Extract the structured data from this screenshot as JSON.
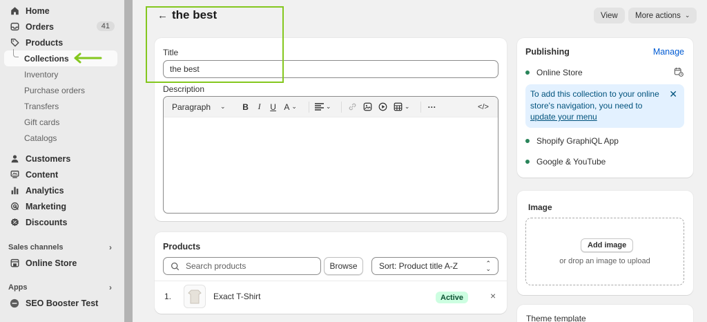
{
  "sidebar": {
    "items": [
      {
        "label": "Home",
        "icon": "home-icon"
      },
      {
        "label": "Orders",
        "icon": "inbox-icon",
        "badge": "41"
      },
      {
        "label": "Products",
        "icon": "tag-icon"
      }
    ],
    "products_sub": [
      {
        "label": "Collections",
        "active": true
      },
      {
        "label": "Inventory"
      },
      {
        "label": "Purchase orders"
      },
      {
        "label": "Transfers"
      },
      {
        "label": "Gift cards"
      },
      {
        "label": "Catalogs"
      }
    ],
    "items2": [
      {
        "label": "Customers",
        "icon": "person-icon"
      },
      {
        "label": "Content",
        "icon": "content-icon"
      },
      {
        "label": "Analytics",
        "icon": "bar-chart-icon"
      },
      {
        "label": "Marketing",
        "icon": "target-icon"
      },
      {
        "label": "Discounts",
        "icon": "discount-icon"
      }
    ],
    "sales_channels_title": "Sales channels",
    "online_store": "Online Store",
    "apps_title": "Apps",
    "seo_app": "SEO Booster Test"
  },
  "header": {
    "title": "the best",
    "view_label": "View",
    "more_actions_label": "More actions"
  },
  "details": {
    "title_label": "Title",
    "title_value": "the best",
    "description_label": "Description",
    "format_label": "Paragraph"
  },
  "products": {
    "title": "Products",
    "search_placeholder": "Search products",
    "browse_label": "Browse",
    "sort_label": "Sort: Product title A-Z",
    "rows": [
      {
        "index": "1.",
        "name": "Exact T-Shirt",
        "status": "Active"
      }
    ]
  },
  "publishing": {
    "title": "Publishing",
    "manage_label": "Manage",
    "channels": [
      "Online Store",
      "Shopify GraphiQL App",
      "Google & YouTube"
    ],
    "banner_text": "To add this collection to your online store's navigation, you need to ",
    "banner_link": "update your menu"
  },
  "image_card": {
    "title": "Image",
    "add_label": "Add image",
    "drop_text": "or drop an image to upload"
  },
  "theme_card": {
    "title": "Theme template"
  },
  "colors": {
    "accent_highlight": "#84c71e",
    "link": "#005bd3",
    "active_badge_bg": "#cdfee1",
    "published_dot": "#29845a"
  }
}
